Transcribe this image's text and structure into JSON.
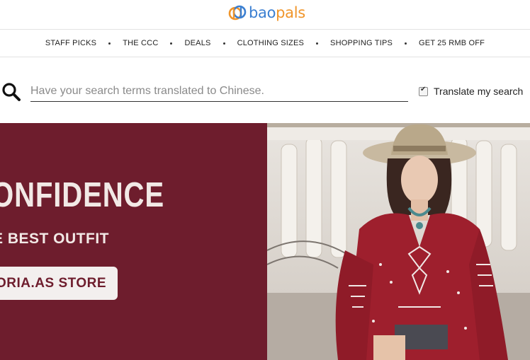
{
  "header": {
    "logo_part1": "bao",
    "logo_part2": "pals"
  },
  "nav": {
    "items": [
      {
        "label": "STAFF PICKS"
      },
      {
        "label": "THE CCC"
      },
      {
        "label": "DEALS"
      },
      {
        "label": "CLOTHING SIZES"
      },
      {
        "label": "SHOPPING TIPS"
      },
      {
        "label": "GET 25 RMB OFF"
      }
    ]
  },
  "search": {
    "placeholder": "Have your search terms translated to Chinese.",
    "value": "",
    "translate_label": "Translate my search",
    "translate_checked": true
  },
  "banner": {
    "headline": "ONFIDENCE",
    "subtitle": "E BEST OUTFIT",
    "cta_label": "ORIA.AS STORE"
  },
  "colors": {
    "brand_blue": "#3b7fd1",
    "brand_orange": "#f0952a",
    "banner_background": "#6e1d2d",
    "banner_text": "#f2e9e6"
  }
}
